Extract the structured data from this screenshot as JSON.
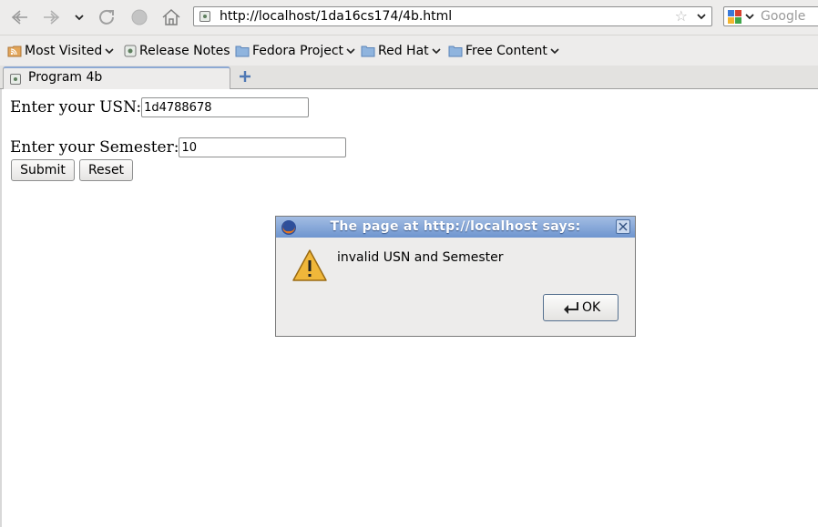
{
  "browser": {
    "url": "http://localhost/1da16cs174/4b.html",
    "search_placeholder": "Google"
  },
  "bookmarks": [
    {
      "label": "Most Visited",
      "icon": "rss-folder-icon",
      "menu": true
    },
    {
      "label": "Release Notes",
      "icon": "page-icon",
      "menu": false
    },
    {
      "label": "Fedora Project",
      "icon": "folder-icon",
      "menu": true
    },
    {
      "label": "Red Hat",
      "icon": "folder-icon",
      "menu": true
    },
    {
      "label": "Free Content",
      "icon": "folder-icon",
      "menu": true
    }
  ],
  "tabs": [
    {
      "label": "Program 4b",
      "active": true
    }
  ],
  "form": {
    "usn_label": "Enter your USN:",
    "usn_value": "1d4788678",
    "sem_label": "Enter your Semester:",
    "sem_value": "10",
    "submit_label": "Submit",
    "reset_label": "Reset"
  },
  "dialog": {
    "title": "The page at http://localhost says:",
    "message": "invalid USN and Semester",
    "ok_label": "OK"
  },
  "colors": {
    "dialog_titlebar": "#7a9dd3",
    "toolbar_bg": "#edeceb",
    "warning_yellow": "#f0b73a"
  }
}
